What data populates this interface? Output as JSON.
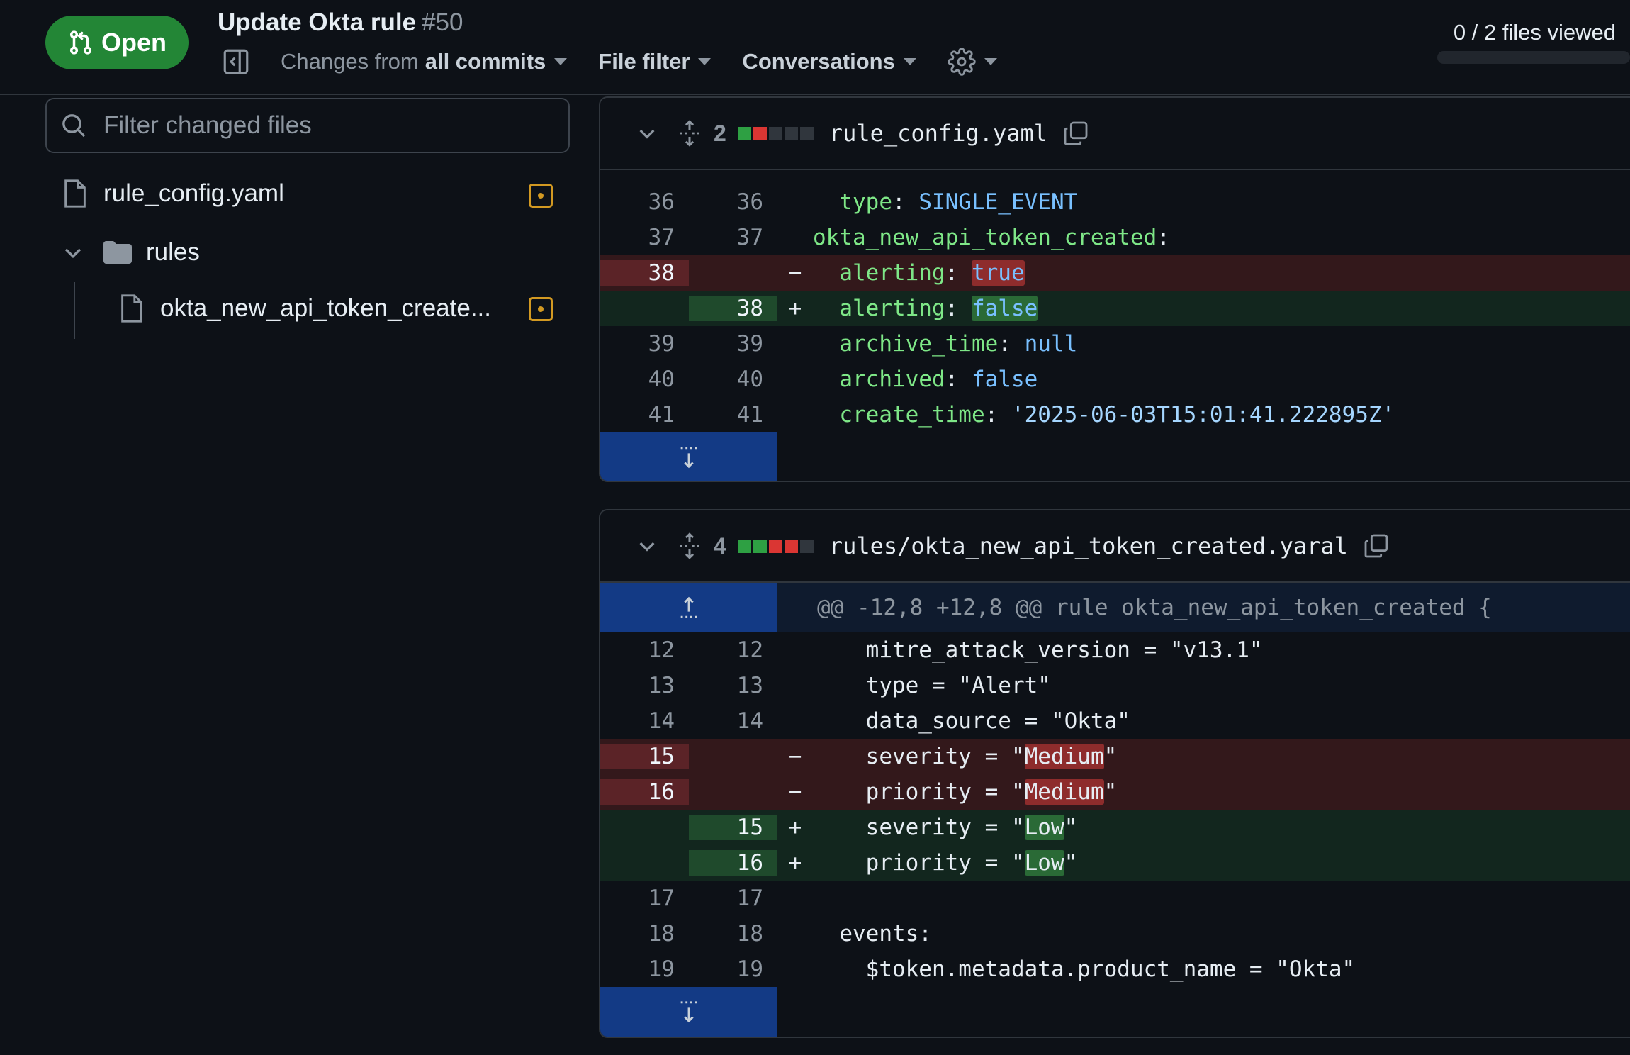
{
  "header": {
    "status": "Open",
    "title": "Update Okta rule",
    "number": "#50",
    "changes_prefix": "Changes from",
    "changes_value": "all commits",
    "file_filter": "File filter",
    "conversations": "Conversations",
    "files_viewed": "0 / 2 files viewed"
  },
  "sidebar": {
    "filter_placeholder": "Filter changed files",
    "items": [
      {
        "label": "rule_config.yaml",
        "type": "file"
      },
      {
        "label": "rules",
        "type": "folder"
      },
      {
        "label": "okta_new_api_token_create...",
        "type": "file"
      }
    ]
  },
  "colors": {
    "accent_green": "#238636",
    "del_bg": "#33181b",
    "add_bg": "#12261e",
    "modified": "#d29922"
  },
  "files": [
    {
      "changes": "2",
      "name": "rule_config.yaml",
      "blocks": [
        "green",
        "red",
        "gray",
        "gray",
        "gray"
      ],
      "lines": [
        {
          "old": "36",
          "new": "36",
          "sign": "",
          "type": "ctx",
          "indent": "  ",
          "key": "type",
          "sep": ": ",
          "val": "SINGLE_EVENT"
        },
        {
          "old": "37",
          "new": "37",
          "sign": "",
          "type": "ctx",
          "indent": "",
          "key": "okta_new_api_token_created",
          "sep": ":",
          "val": ""
        },
        {
          "old": "38",
          "new": "",
          "sign": "−",
          "type": "del",
          "indent": "  ",
          "key": "alerting",
          "sep": ": ",
          "val": "true"
        },
        {
          "old": "",
          "new": "38",
          "sign": "+",
          "type": "add",
          "indent": "  ",
          "key": "alerting",
          "sep": ": ",
          "val": "false"
        },
        {
          "old": "39",
          "new": "39",
          "sign": "",
          "type": "ctx",
          "indent": "  ",
          "key": "archive_time",
          "sep": ": ",
          "val": "null"
        },
        {
          "old": "40",
          "new": "40",
          "sign": "",
          "type": "ctx",
          "indent": "  ",
          "key": "archived",
          "sep": ": ",
          "val": "false"
        },
        {
          "old": "41",
          "new": "41",
          "sign": "",
          "type": "ctx",
          "indent": "  ",
          "key": "create_time",
          "sep": ": ",
          "val": "'2025-06-03T15:01:41.222895Z'"
        }
      ]
    },
    {
      "changes": "4",
      "name": "rules/okta_new_api_token_created.yaral",
      "blocks": [
        "green",
        "green",
        "red",
        "red",
        "gray"
      ],
      "hunk": "@@ -12,8 +12,8 @@ rule okta_new_api_token_created {",
      "lines": [
        {
          "old": "12",
          "new": "12",
          "sign": "",
          "type": "ctx",
          "pre": "    mitre_attack_version = \"v13.1\"",
          "hl": "",
          "post": ""
        },
        {
          "old": "13",
          "new": "13",
          "sign": "",
          "type": "ctx",
          "pre": "    type = \"Alert\"",
          "hl": "",
          "post": ""
        },
        {
          "old": "14",
          "new": "14",
          "sign": "",
          "type": "ctx",
          "pre": "    data_source = \"Okta\"",
          "hl": "",
          "post": ""
        },
        {
          "old": "15",
          "new": "",
          "sign": "−",
          "type": "del",
          "pre": "    severity = \"",
          "hl": "Medium",
          "post": "\""
        },
        {
          "old": "16",
          "new": "",
          "sign": "−",
          "type": "del",
          "pre": "    priority = \"",
          "hl": "Medium",
          "post": "\""
        },
        {
          "old": "",
          "new": "15",
          "sign": "+",
          "type": "add",
          "pre": "    severity = \"",
          "hl": "Low",
          "post": "\""
        },
        {
          "old": "",
          "new": "16",
          "sign": "+",
          "type": "add",
          "pre": "    priority = \"",
          "hl": "Low",
          "post": "\""
        },
        {
          "old": "17",
          "new": "17",
          "sign": "",
          "type": "ctx",
          "pre": "",
          "hl": "",
          "post": ""
        },
        {
          "old": "18",
          "new": "18",
          "sign": "",
          "type": "ctx",
          "pre": "  events:",
          "hl": "",
          "post": ""
        },
        {
          "old": "19",
          "new": "19",
          "sign": "",
          "type": "ctx",
          "pre": "    $token.metadata.product_name = \"Okta\"",
          "hl": "",
          "post": ""
        }
      ]
    }
  ]
}
